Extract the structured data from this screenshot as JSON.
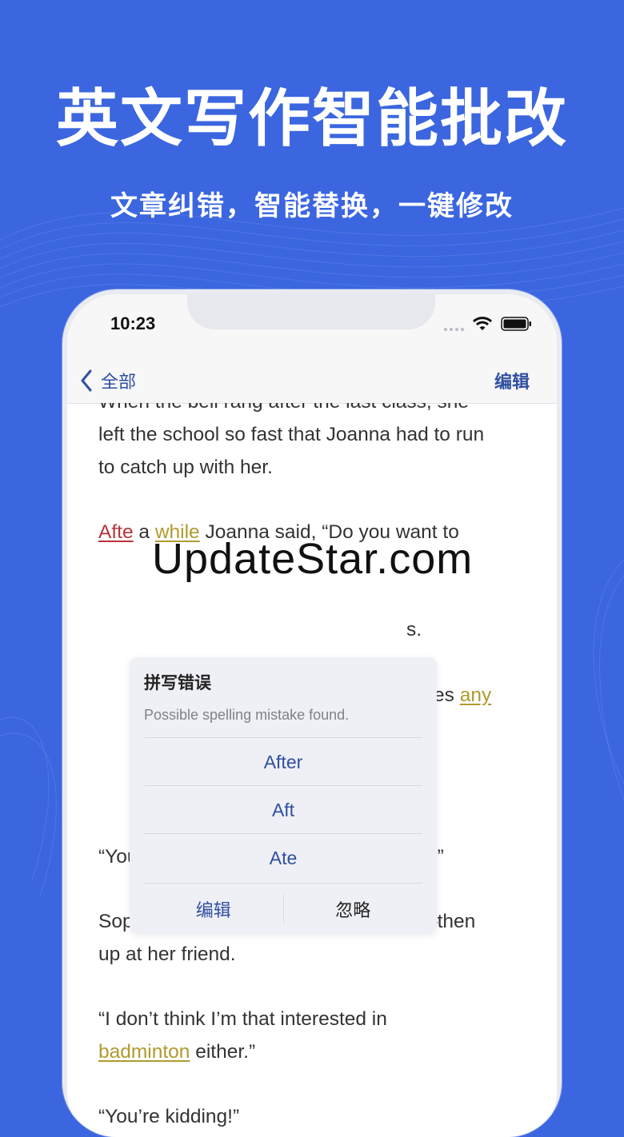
{
  "headline": "英文写作智能批改",
  "subheadline": "文章纠错，智能替换，一键修改",
  "status_bar": {
    "time": "10:23"
  },
  "nav": {
    "back_label": "全部",
    "edit_label": "编辑"
  },
  "document": {
    "para1_line0": "When the bell rang after the last class, she",
    "para1_line1": "left the school so fast that Joanna had to run",
    "para1_line2": "to catch up with her.",
    "para2_err1": "Afte",
    "para2_mid1": " a ",
    "para2_err2": "while",
    "para2_rest": " Joanna said, “Do you want to",
    "hidden_line_fragment": "s.",
    "hidden_line2_visible": "ames ",
    "hidden_line2_err": "any",
    "para3": "“You’re not? Let’s play badminton then.”",
    "para4_line1": "Sophie stared down at the pavement—then",
    "para4_line2": "up at her friend.",
    "para5_line1": "“I don’t think I’m that interested in",
    "para5_err": "badminton",
    "para5_rest": " either.”",
    "para6": "“You’re kidding!”"
  },
  "popup": {
    "title": "拼写错误",
    "description": "Possible spelling mistake found.",
    "suggestions": [
      "After",
      "Aft",
      "Ate"
    ],
    "edit_label": "编辑",
    "ignore_label": "忽略"
  },
  "watermark": "UpdateStar.com",
  "colors": {
    "background": "#3b66e0",
    "accent": "#2f4fa0",
    "error_red": "#b8333a",
    "error_yellow": "#b09a2e"
  }
}
